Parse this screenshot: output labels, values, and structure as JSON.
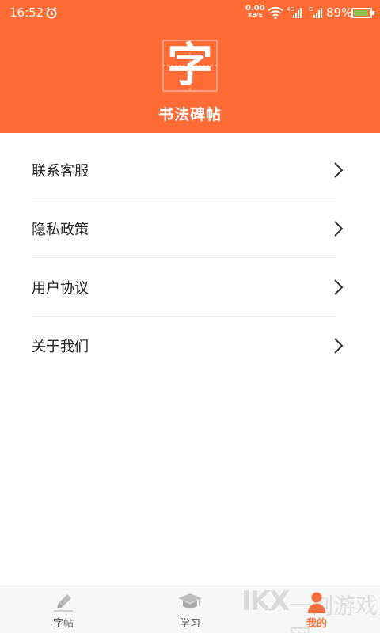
{
  "status_bar": {
    "time": "16:52",
    "net_speed_value": "0.00",
    "net_speed_unit": "KB/S",
    "battery_percent": "89%",
    "battery_level": 0.89,
    "icons": [
      "alarm-icon",
      "wifi-icon",
      "signal-icon",
      "signal-icon",
      "battery-icon"
    ]
  },
  "header": {
    "logo_char": "字",
    "title": "书法碑帖",
    "background_color": "#FF6B35"
  },
  "menu": {
    "items": [
      {
        "label": "联系客服"
      },
      {
        "label": "隐私政策"
      },
      {
        "label": "用户协议"
      },
      {
        "label": "关于我们"
      }
    ]
  },
  "tabbar": {
    "tabs": [
      {
        "label": "字帖",
        "icon": "pencil-icon",
        "active": false
      },
      {
        "label": "学习",
        "icon": "graduation-cap-icon",
        "active": false
      },
      {
        "label": "我的",
        "icon": "person-icon",
        "active": true
      }
    ],
    "active_color": "#FF6B35"
  },
  "watermark": {
    "text": "IKX",
    "text2": "一刻游戏网"
  }
}
